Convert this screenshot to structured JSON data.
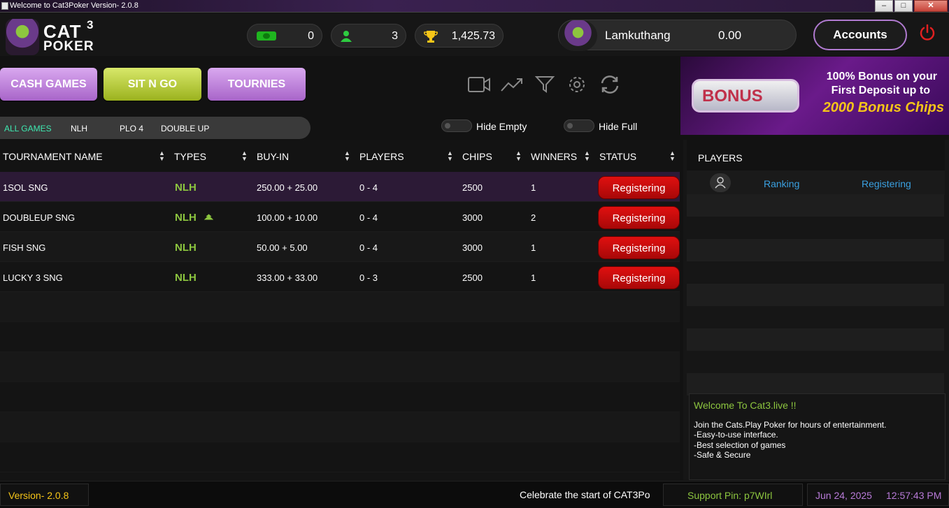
{
  "window": {
    "title": "Welcome to Cat3Poker Version- 2.0.8",
    "min_label": "–",
    "max_label": "□",
    "close_label": "✕"
  },
  "logo": {
    "cat": "CAT",
    "superscript": "3",
    "poker": "POKER"
  },
  "stats": {
    "cash": "0",
    "players": "3",
    "trophy": "1,425.73"
  },
  "user": {
    "name": "Lamkuthang",
    "balance": "0.00"
  },
  "accounts_label": "Accounts",
  "nav": {
    "cash_games": "CASH GAMES",
    "sit_n_go": "SIT N GO",
    "tournies": "TOURNIES"
  },
  "toolbar_icons": [
    "video-icon",
    "trend-chart-icon",
    "filter-icon",
    "settings-icon",
    "refresh-icon"
  ],
  "filters": [
    {
      "label": "ALL GAMES",
      "active": true
    },
    {
      "label": "NLH",
      "active": false
    },
    {
      "label": "PLO 4",
      "active": false
    },
    {
      "label": "DOUBLE UP",
      "active": false
    }
  ],
  "toggles": {
    "hide_empty": "Hide Empty",
    "hide_full": "Hide Full"
  },
  "banner": {
    "bonus_word": "BONUS",
    "line1": "100% Bonus on your",
    "line2": "First Deposit up to",
    "line3": "2000 Bonus Chips"
  },
  "table": {
    "headers": [
      "TOURNAMENT NAME",
      "TYPES",
      "BUY-IN",
      "PLAYERS",
      "CHIPS",
      "WINNERS",
      "STATUS"
    ],
    "rows": [
      {
        "name": "1SOL SNG",
        "type": "NLH",
        "buyin": "250.00 + 25.00",
        "players": "0 - 4",
        "chips": "2500",
        "winners": "1",
        "status": "Registering",
        "double_up": false
      },
      {
        "name": "DOUBLEUP SNG",
        "type": "NLH",
        "buyin": "100.00 + 10.00",
        "players": "0 - 4",
        "chips": "3000",
        "winners": "2",
        "status": "Registering",
        "double_up": true
      },
      {
        "name": "FISH SNG",
        "type": "NLH",
        "buyin": "50.00 + 5.00",
        "players": "0 - 4",
        "chips": "3000",
        "winners": "1",
        "status": "Registering",
        "double_up": false
      },
      {
        "name": "LUCKY 3 SNG",
        "type": "NLH",
        "buyin": "333.00 + 33.00",
        "players": "0 - 3",
        "chips": "2500",
        "winners": "1",
        "status": "Registering",
        "double_up": false
      }
    ]
  },
  "players_panel": {
    "title": "PLAYERS",
    "ranking": "Ranking",
    "registering": "Registering"
  },
  "welcome": {
    "title": "Welcome To Cat3.live !!",
    "lines": [
      "Join the Cats.Play Poker for hours of entertainment.",
      "-Easy-to-use interface.",
      "-Best selection of games",
      "-Safe & Secure"
    ]
  },
  "footer": {
    "version": "Version- 2.0.8",
    "ticker": "Celebrate the start of CAT3Po",
    "support_pin": "Support Pin: p7WIrl",
    "date": "Jun 24, 2025",
    "time": "12:57:43 PM"
  },
  "colors": {
    "accent_green": "#8dc63f",
    "status_red": "#d40c0c",
    "link_blue": "#3aa0e0",
    "active_filter": "#3ee8b0"
  }
}
